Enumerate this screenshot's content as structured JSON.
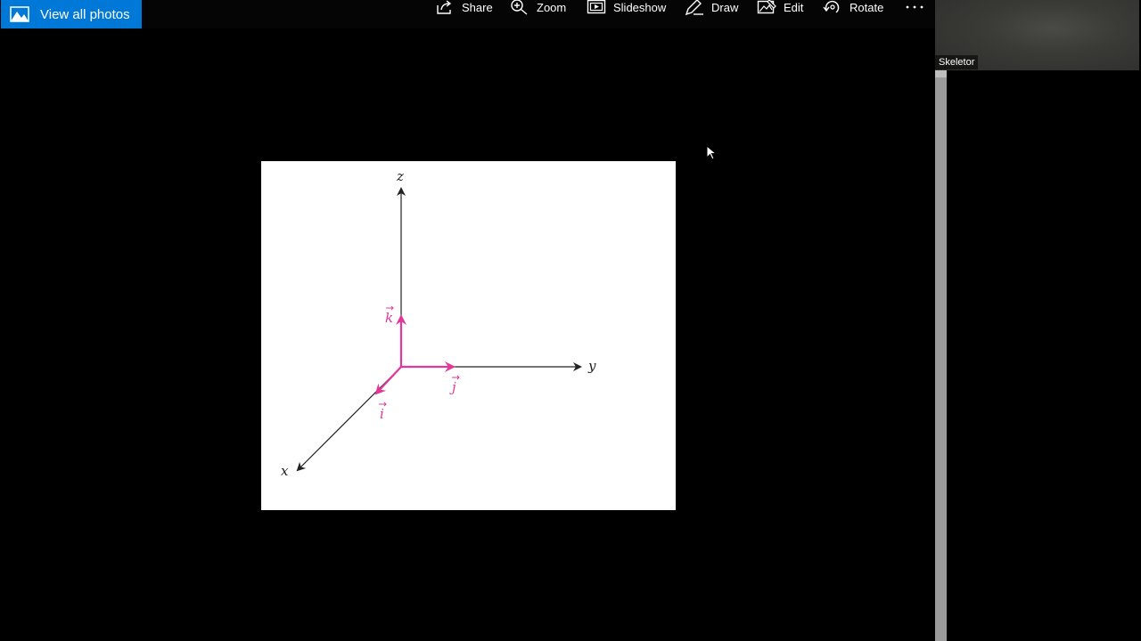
{
  "toolbar": {
    "view_all_label": "View all photos",
    "share_label": "Share",
    "zoom_label": "Zoom",
    "slideshow_label": "Slideshow",
    "draw_label": "Draw",
    "edit_label": "Edit",
    "rotate_label": "Rotate",
    "more_icon": "more-horizontal-icon"
  },
  "figure": {
    "axes": {
      "z": "z",
      "y": "y",
      "x": "x"
    },
    "unit_vectors": {
      "k": "k",
      "j": "j",
      "i": "i"
    },
    "colors": {
      "axis": "#222222",
      "unit_vector": "#e0399a"
    }
  },
  "webcam": {
    "participant_name": "Skeletor"
  },
  "colors": {
    "accent": "#0078d7",
    "background": "#000000"
  }
}
